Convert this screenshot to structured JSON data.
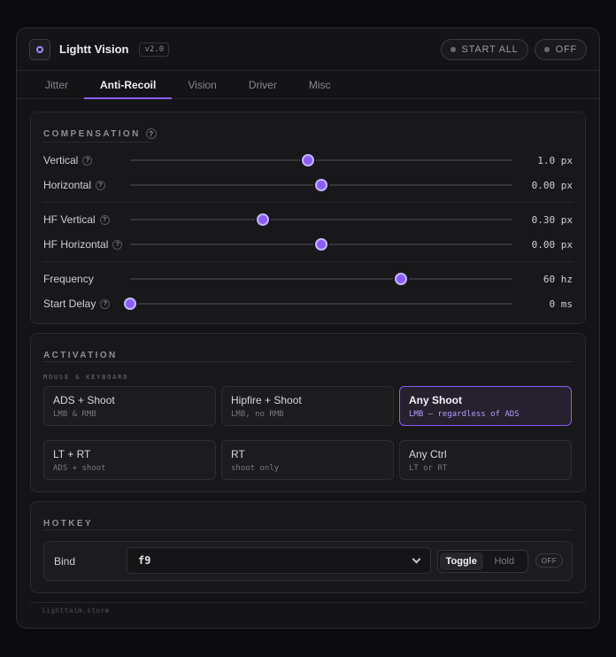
{
  "app": {
    "title": "Lightt Vision",
    "version": "v2.0",
    "start_all_label": "START ALL",
    "power_label": "OFF",
    "accent_color": "#8b5cf6"
  },
  "tabs": [
    {
      "label": "Jitter",
      "active": false
    },
    {
      "label": "Anti-Recoil",
      "active": true
    },
    {
      "label": "Vision",
      "active": false
    },
    {
      "label": "Driver",
      "active": false
    },
    {
      "label": "Misc",
      "active": false
    }
  ],
  "compensation": {
    "header": "COMPENSATION",
    "help": "?",
    "sliders": [
      {
        "label": "Vertical",
        "value": "1.0 px",
        "level": 0.465,
        "help": true
      },
      {
        "label": "Horizontal",
        "value": "0.00 px",
        "level": 0.5,
        "help": true
      },
      {
        "label": "HF Vertical",
        "value": "0.30 px",
        "level": 0.347,
        "help": true
      },
      {
        "label": "HF Horizontal",
        "value": "0.00 px",
        "level": 0.5,
        "help": true
      },
      {
        "label": "Frequency",
        "value": "60 hz",
        "level": 0.708,
        "help": false
      },
      {
        "label": "Start Delay",
        "value": "0 ms",
        "level": 0.0,
        "help": true
      }
    ]
  },
  "activation": {
    "header": "ACTIVATION",
    "group_label": "MOUSE & KEYBOARD",
    "options": [
      {
        "title": "ADS + Shoot",
        "sub": "LMB & RMB",
        "selected": false
      },
      {
        "title": "Hipfire + Shoot",
        "sub": "LMB, no RMB",
        "selected": false
      },
      {
        "title": "Any Shoot",
        "sub": "LMB — regardless of ADS",
        "selected": true
      },
      {
        "title": "LT + RT",
        "sub": "ADS + shoot",
        "selected": false
      },
      {
        "title": "RT",
        "sub": "shoot only",
        "selected": false
      },
      {
        "title": "Any Ctrl",
        "sub": "LT or RT",
        "selected": false
      }
    ]
  },
  "hotkey": {
    "header": "HOTKEY",
    "bind_label": "Bind",
    "bind_value": "f9",
    "mode_toggle": "Toggle",
    "mode_hold": "Hold",
    "mode_active": "Toggle",
    "state": "OFF"
  },
  "footer": {
    "text": "lighttaim.store"
  }
}
